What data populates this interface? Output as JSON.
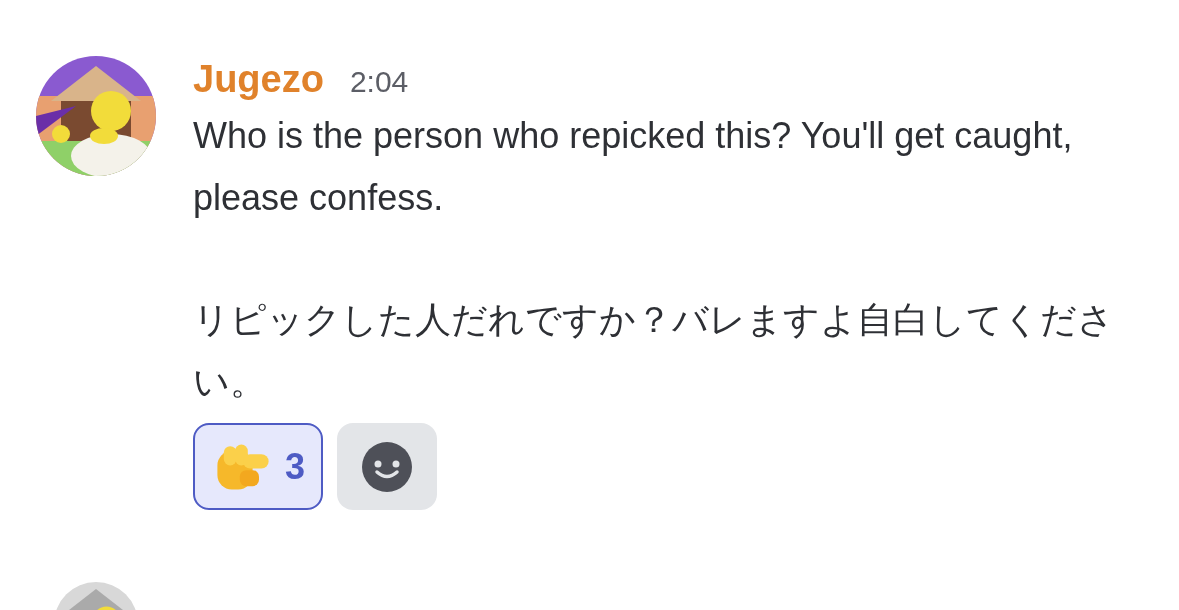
{
  "messages": [
    {
      "avatar": {
        "kind": "picture"
      },
      "author": "Jugezo",
      "time": "2:04",
      "paragraphs": [
        "Who is the person who repicked this? You'll get caught, please confess.",
        "リピックした人だれですか？バレますよ自白してください。"
      ],
      "reactions": [
        {
          "count": "3",
          "selected": true
        }
      ]
    },
    {
      "avatar": {
        "kind": "picture"
      }
    }
  ]
}
